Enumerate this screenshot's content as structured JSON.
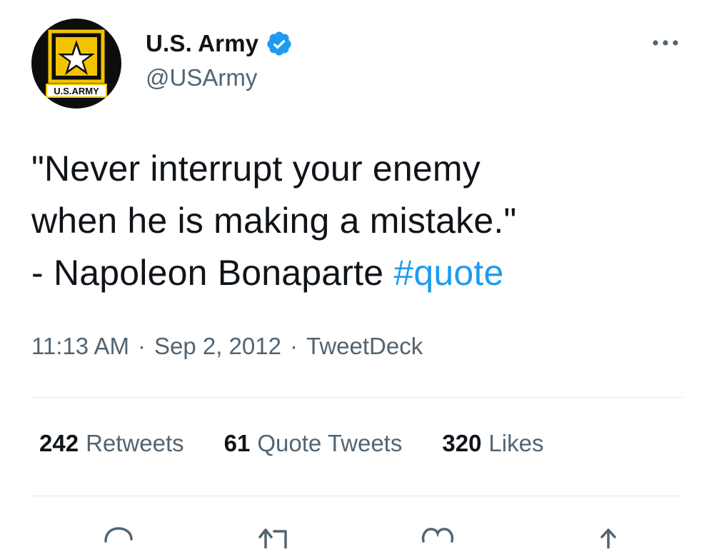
{
  "author": {
    "display_name": "U.S. Army",
    "handle": "@USArmy",
    "avatar_badge_text": "U.S.ARMY",
    "verified": true
  },
  "icons": {
    "verified": "verified-badge-icon",
    "more": "more-options-icon",
    "reply": "reply-icon",
    "retweet": "retweet-icon",
    "like": "like-icon",
    "share": "share-icon"
  },
  "tweet": {
    "lines": [
      "\"Never interrupt your enemy",
      "when he is making a mistake.\"",
      "- Napoleon Bonaparte "
    ],
    "hashtag": "#quote",
    "time": "11:13 AM",
    "date": "Sep 2, 2012",
    "source": "TweetDeck",
    "separator": "·"
  },
  "stats": {
    "retweets": {
      "count": "242",
      "label": "Retweets"
    },
    "quotes": {
      "count": "61",
      "label": "Quote Tweets"
    },
    "likes": {
      "count": "320",
      "label": "Likes"
    }
  },
  "colors": {
    "text": "#0f1419",
    "secondary": "#536471",
    "accent": "#1d9bf0",
    "army_gold": "#f2c300"
  }
}
